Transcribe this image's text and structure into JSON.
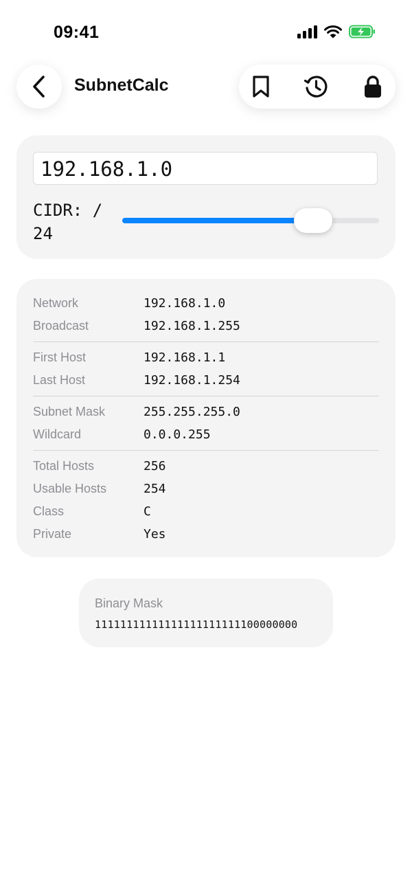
{
  "status_bar": {
    "time": "09:41"
  },
  "header": {
    "title": "SubnetCalc"
  },
  "input": {
    "ip_value": "192.168.1.0",
    "cidr_label": "CIDR: / 24",
    "cidr_value": 24,
    "cidr_max": 32
  },
  "results": [
    {
      "label": "Network",
      "value": "192.168.1.0"
    },
    {
      "label": "Broadcast",
      "value": "192.168.1.255"
    },
    {
      "label": "First Host",
      "value": "192.168.1.1"
    },
    {
      "label": "Last Host",
      "value": "192.168.1.254"
    },
    {
      "label": "Subnet Mask",
      "value": "255.255.255.0"
    },
    {
      "label": "Wildcard",
      "value": "0.0.0.255"
    },
    {
      "label": "Total Hosts",
      "value": "256"
    },
    {
      "label": "Usable Hosts",
      "value": "254"
    },
    {
      "label": "Class",
      "value": "C"
    },
    {
      "label": "Private",
      "value": "Yes"
    }
  ],
  "binary": {
    "label": "Binary Mask",
    "value": "11111111111111111111111100000000"
  },
  "icons": {
    "back": "chevron-left-icon",
    "bookmark": "bookmark-icon",
    "history": "history-icon",
    "lock": "lock-icon"
  },
  "colors": {
    "accent": "#0a84ff",
    "battery": "#34c759",
    "card_bg": "#f4f4f5",
    "muted_text": "#8e8e93"
  }
}
